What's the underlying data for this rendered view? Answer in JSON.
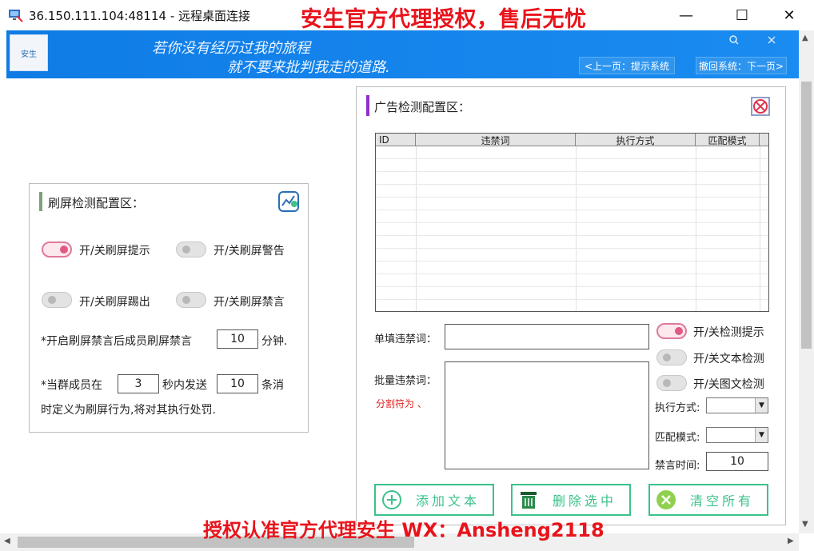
{
  "window": {
    "title": "36.150.111.104:48114 - 远程桌面连接",
    "watermark_top": "安生官方代理授权，售后无忧",
    "watermark_bottom": "授权认准官方代理安生 WX：Ansheng2118",
    "min_label": "—",
    "max_label": "☐",
    "close_label": "✕"
  },
  "banner": {
    "logo_text": "安生",
    "motto_line1": "若你没有经历过我的旅程",
    "motto_line2": "就不要来批判我走的道路.",
    "prev_button": "<上一页：提示系统",
    "next_button": "撤回系统：下一页>",
    "search_icon": "search-icon",
    "close_icon": "close-icon"
  },
  "flood_panel": {
    "title": "刷屏检测配置区：",
    "accent_color": "#7da07d",
    "toggles": [
      {
        "label": "开/关刷屏提示",
        "on": true
      },
      {
        "label": "开/关刷屏警告",
        "on": false
      },
      {
        "label": "开/关刷屏踢出",
        "on": false
      },
      {
        "label": "开/关刷屏禁言",
        "on": false
      }
    ],
    "mute_prefix": "*开启刷屏禁言后成员刷屏禁言",
    "mute_minutes": "10",
    "mute_suffix": "分钟.",
    "rule_prefix": "*当群成员在",
    "rule_seconds": "3",
    "rule_middle": "秒内发送",
    "rule_count": "10",
    "rule_suffix": "条消",
    "rule_line2": "时定义为刷屏行为,将对其执行处罚."
  },
  "ad_panel": {
    "title": "广告检测配置区：",
    "accent_color": "#8e2fd0",
    "table": {
      "columns": [
        "ID",
        "违禁词",
        "执行方式",
        "匹配模式"
      ],
      "rows": []
    },
    "single_label": "单填违禁词：",
    "single_value": "",
    "batch_label": "批量违禁词：",
    "batch_hint": "分割符为 、",
    "batch_value": "",
    "toggles": [
      {
        "label": "开/关检测提示",
        "on": true
      },
      {
        "label": "开/关文本检测",
        "on": false
      },
      {
        "label": "开/关图文检测",
        "on": false
      }
    ],
    "exec_label": "执行方式:",
    "exec_value": "",
    "match_label": "匹配模式:",
    "match_value": "",
    "mute_label": "禁言时间:",
    "mute_value": "10",
    "buttons": {
      "add": "添加文本",
      "delete": "删除选中",
      "clear": "清空所有"
    }
  },
  "colors": {
    "banner_blue": "#1486ec",
    "watermark_red": "#e8141c",
    "toggle_on": "#e05a82",
    "button_green": "#3cc28a"
  }
}
